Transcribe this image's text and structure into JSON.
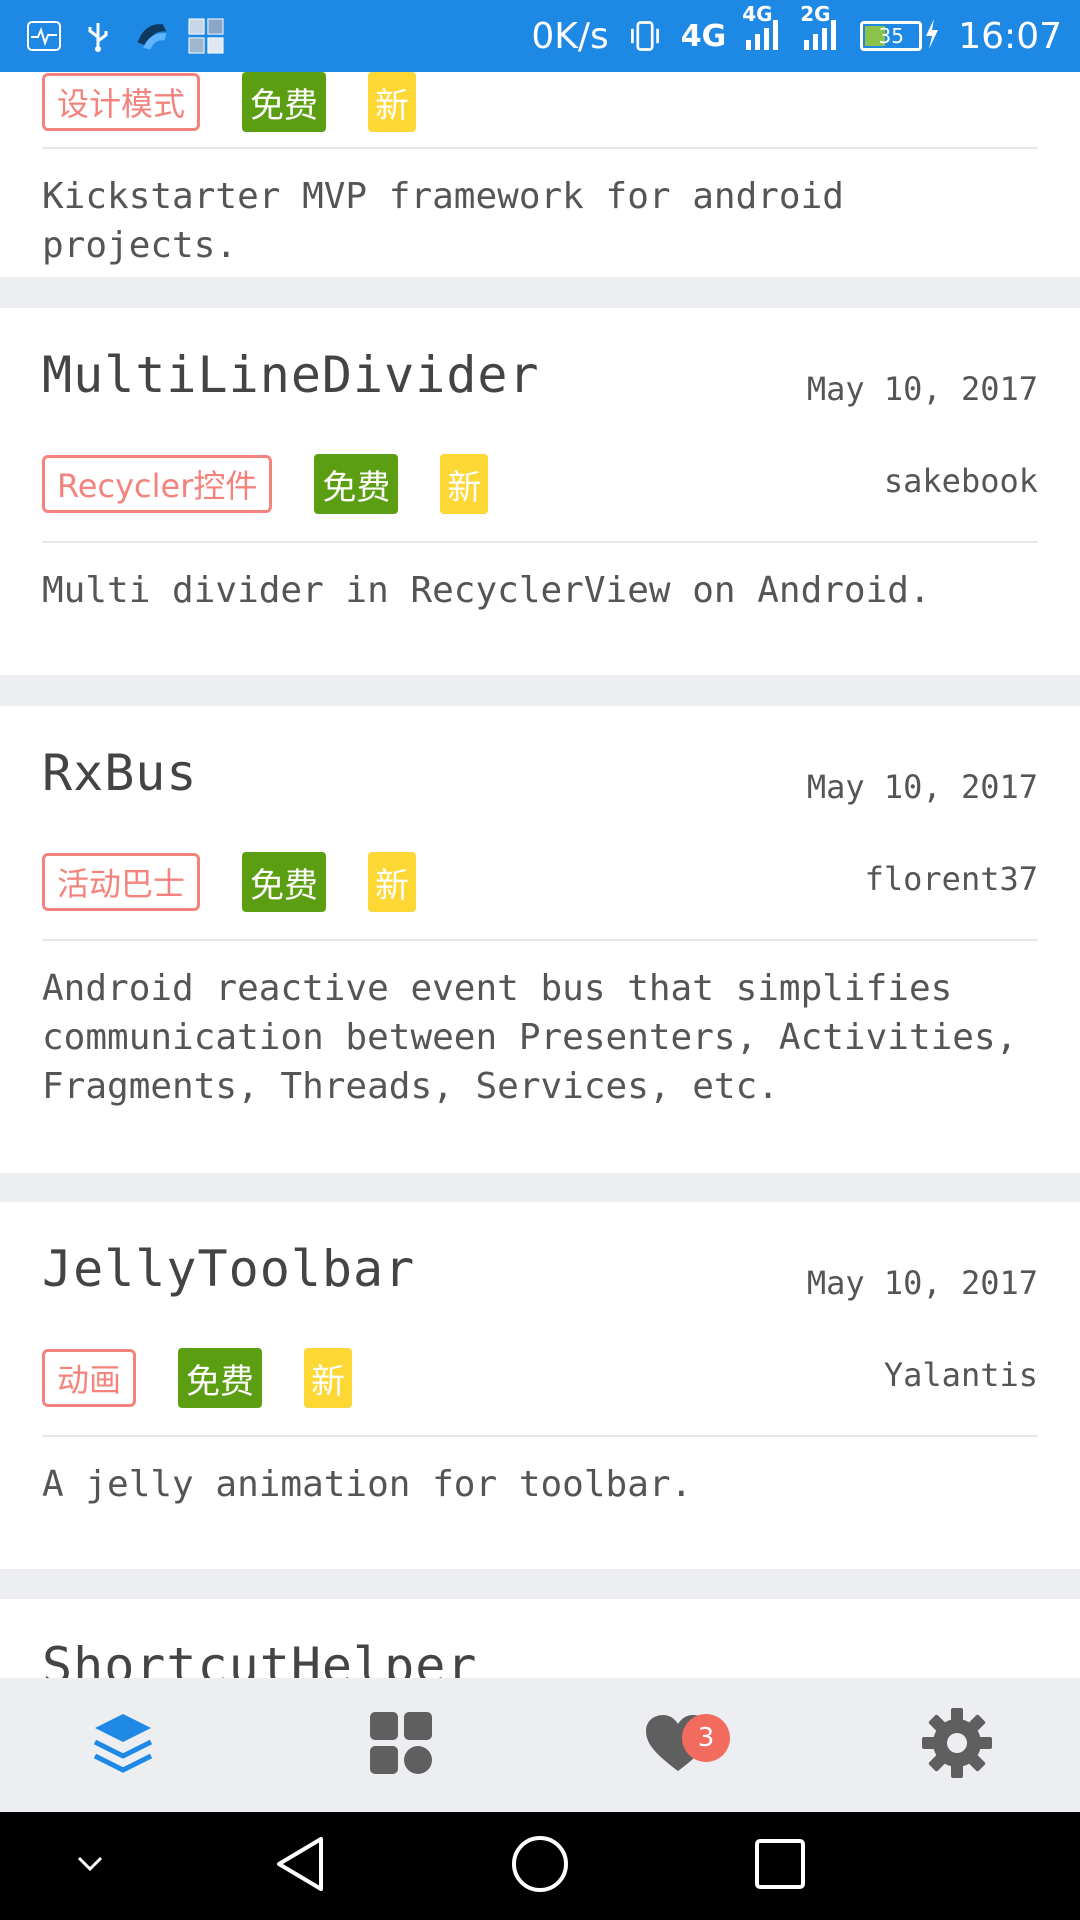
{
  "status_bar": {
    "net_speed": "0K/s",
    "network_1": "4G",
    "network_1_sup": "4G",
    "network_2": "2G",
    "battery": "35",
    "time": "16:07",
    "icons": [
      "health-icon",
      "usb-icon",
      "app-icon",
      "gallery-icon",
      "vibrate-icon",
      "signal-icon",
      "battery-icon",
      "charging-icon"
    ]
  },
  "cards": [
    {
      "title": "",
      "date": "",
      "author": "",
      "category": "设计模式",
      "free": "免费",
      "new": "新",
      "desc": "Kickstarter MVP framework for android projects."
    },
    {
      "title": "MultiLineDivider",
      "date": "May 10, 2017",
      "author": "sakebook",
      "category": "Recycler控件",
      "free": "免费",
      "new": "新",
      "desc": "Multi divider in RecyclerView on Android."
    },
    {
      "title": "RxBus",
      "date": "May 10, 2017",
      "author": "florent37",
      "category": "活动巴士",
      "free": "免费",
      "new": "新",
      "desc": "Android reactive event bus that simplifies communication between Presenters, Activities, Fragments, Threads, Services, etc."
    },
    {
      "title": "JellyToolbar",
      "date": "May 10, 2017",
      "author": "Yalantis",
      "category": "动画",
      "free": "免费",
      "new": "新",
      "desc": "A jelly animation for toolbar."
    },
    {
      "title": "ShortcutHelper"
    }
  ],
  "bottom_nav": {
    "items": [
      {
        "icon": "layers-icon",
        "active": true
      },
      {
        "icon": "grid-icon",
        "active": false
      },
      {
        "icon": "heart-icon",
        "active": false,
        "badge": "3"
      },
      {
        "icon": "gear-icon",
        "active": false
      }
    ],
    "active_color": "#1e88e5",
    "inactive_color": "#5f5f5f"
  },
  "system_nav": {
    "icons": [
      "chevron-down-icon",
      "back-icon",
      "home-icon",
      "recents-icon"
    ]
  }
}
